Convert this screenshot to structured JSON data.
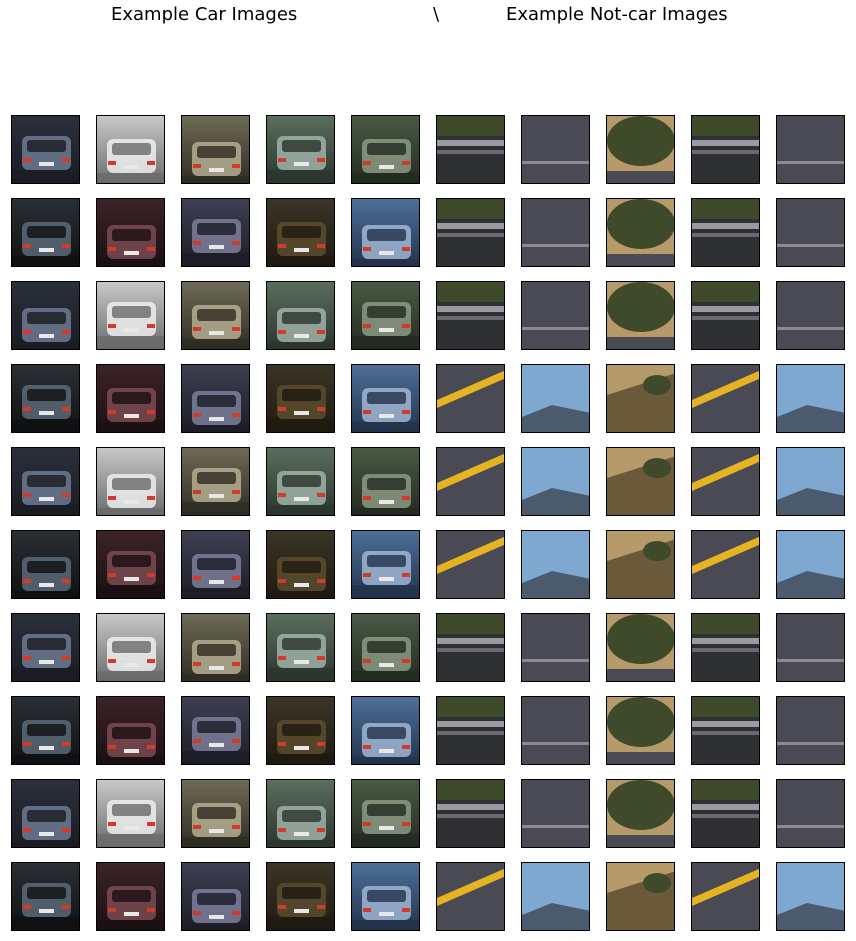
{
  "figure": {
    "left_title": "Example Car Images",
    "separator": "\\",
    "right_title": "Example Not-car Images"
  },
  "grid": {
    "rows": 10,
    "columns": 10,
    "car_columns": 5,
    "notcar_columns": 5,
    "tiles": [
      [
        "car",
        "car",
        "car",
        "car",
        "car",
        "notcar",
        "notcar",
        "notcar",
        "notcar",
        "notcar"
      ],
      [
        "car",
        "car",
        "car",
        "car",
        "car",
        "notcar",
        "notcar",
        "notcar",
        "notcar",
        "notcar"
      ],
      [
        "car",
        "car",
        "car",
        "car",
        "car",
        "notcar",
        "notcar",
        "notcar",
        "notcar",
        "notcar"
      ],
      [
        "car",
        "car",
        "car",
        "car",
        "car",
        "notcar",
        "notcar",
        "notcar",
        "notcar",
        "notcar"
      ],
      [
        "car",
        "car",
        "car",
        "car",
        "car",
        "notcar",
        "notcar",
        "notcar",
        "notcar",
        "notcar"
      ],
      [
        "car",
        "car",
        "car",
        "car",
        "car",
        "notcar",
        "notcar",
        "notcar",
        "notcar",
        "notcar"
      ],
      [
        "car",
        "car",
        "car",
        "car",
        "car",
        "notcar",
        "notcar",
        "notcar",
        "notcar",
        "notcar"
      ],
      [
        "car",
        "car",
        "car",
        "car",
        "car",
        "notcar",
        "notcar",
        "notcar",
        "notcar",
        "notcar"
      ],
      [
        "car",
        "car",
        "car",
        "car",
        "car",
        "notcar",
        "notcar",
        "notcar",
        "notcar",
        "notcar"
      ],
      [
        "car",
        "car",
        "car",
        "car",
        "car",
        "notcar",
        "notcar",
        "notcar",
        "notcar",
        "notcar"
      ]
    ]
  },
  "colors": {
    "tile_border": "#000000",
    "road_yellow": "#e6b422",
    "road_gray": "#4a4a55",
    "sky_blue": "#7ea8d0",
    "foliage": "#3e4a2a",
    "dry_grass": "#b79a6a"
  }
}
